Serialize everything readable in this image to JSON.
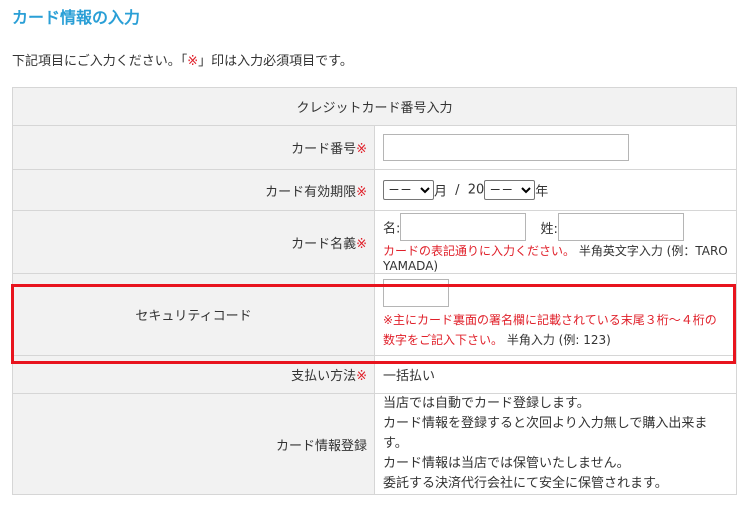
{
  "page": {
    "title": "カード情報の入力",
    "intro_before": "下記項目にご入力ください。「",
    "intro_mark": "※",
    "intro_after": "」印は入力必須項目です。"
  },
  "form": {
    "header": "クレジットカード番号入力",
    "required_mark": "※",
    "card_number": {
      "label": "カード番号",
      "value": "",
      "placeholder": ""
    },
    "expiry": {
      "label": "カード有効期限",
      "month_selected": "－－",
      "month_suffix": "月",
      "separator": "/",
      "year_prefix": "20",
      "year_selected": "－－",
      "year_suffix": "年"
    },
    "card_name": {
      "label": "カード名義",
      "first_label": "名:",
      "last_label": "姓:",
      "note_red": "カードの表記通りに入力ください。",
      "note_black": "半角英文字入力 (例：TARO YAMADA)"
    },
    "security_code": {
      "label": "セキュリティコード",
      "note_red": "※主にカード裏面の署名欄に記載されている末尾３桁～４桁の数字をご記入下さい。",
      "note_black": "半角入力 (例: 123)"
    },
    "payment_method": {
      "label": "支払い方法",
      "value": "一括払い"
    },
    "card_registration": {
      "label": "カード情報登録",
      "lines": [
        "当店では自動でカード登録します。",
        "カード情報を登録すると次回より入力無しで購入出来ます。",
        "カード情報は当店では保管いたしません。",
        "委託する決済代行会社にて安全に保管されます。"
      ]
    }
  },
  "colors": {
    "title": "#2a9fd6",
    "required": "#e0202a",
    "highlight_border": "#e8141e",
    "label_bg": "#f2f2f2"
  }
}
